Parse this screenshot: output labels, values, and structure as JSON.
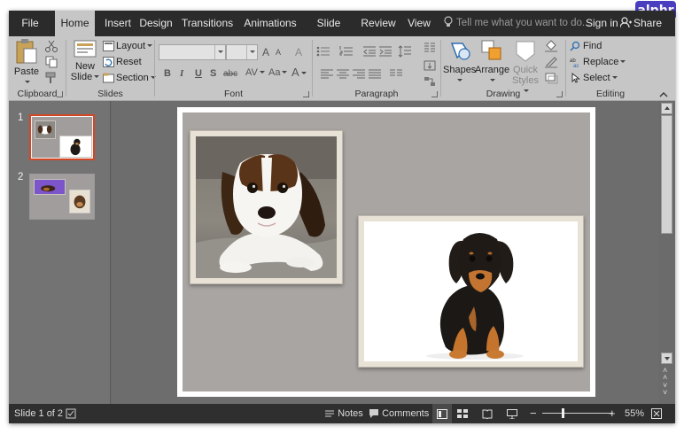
{
  "tabs": [
    {
      "label": "File",
      "active": false
    },
    {
      "label": "Home",
      "active": true
    },
    {
      "label": "Insert",
      "active": false
    },
    {
      "label": "Design",
      "active": false
    },
    {
      "label": "Transitions",
      "active": false
    },
    {
      "label": "Animations",
      "active": false
    },
    {
      "label": "Slide Show",
      "active": false
    },
    {
      "label": "Review",
      "active": false
    },
    {
      "label": "View",
      "active": false
    }
  ],
  "tell_me": {
    "placeholder": "Tell me what you want to do..."
  },
  "account": {
    "sign_in": "Sign in",
    "share": "Share"
  },
  "ribbon": {
    "clipboard": {
      "label": "Clipboard",
      "paste": "Paste"
    },
    "slides": {
      "label": "Slides",
      "new_slide_line1": "New",
      "new_slide_line2": "Slide",
      "layout": "Layout",
      "reset": "Reset",
      "section": "Section"
    },
    "font": {
      "label": "Font",
      "bold": "B",
      "italic": "I",
      "underline": "U",
      "shadow": "S",
      "strike": "abc",
      "spacing": "AV",
      "change_case": "Aa",
      "grow": "A",
      "shrink": "A",
      "color": "A",
      "clear": "A"
    },
    "paragraph": {
      "label": "Paragraph"
    },
    "drawing": {
      "label": "Drawing",
      "shapes": "Shapes",
      "arrange": "Arrange",
      "quick_styles_line1": "Quick",
      "quick_styles_line2": "Styles"
    },
    "editing": {
      "label": "Editing",
      "find": "Find",
      "replace": "Replace",
      "select": "Select"
    }
  },
  "thumbnails": [
    {
      "number": "1",
      "selected": true
    },
    {
      "number": "2",
      "selected": false
    }
  ],
  "status": {
    "slide_info": "Slide 1 of 2",
    "notes": "Notes",
    "comments": "Comments",
    "zoom_level": "55%",
    "zoom_fraction": 0.55
  },
  "logo": {
    "text": "alphr"
  },
  "colors": {
    "tab_bar": "#2b2b2b",
    "ribbon": "#c6c6c6",
    "accent_selection": "#d24726",
    "slide_background": "#a9a5a3",
    "frame": "#e7e1d6",
    "thumb_purple": "#7b55c9",
    "logo_bg": "#4a3ec0"
  }
}
